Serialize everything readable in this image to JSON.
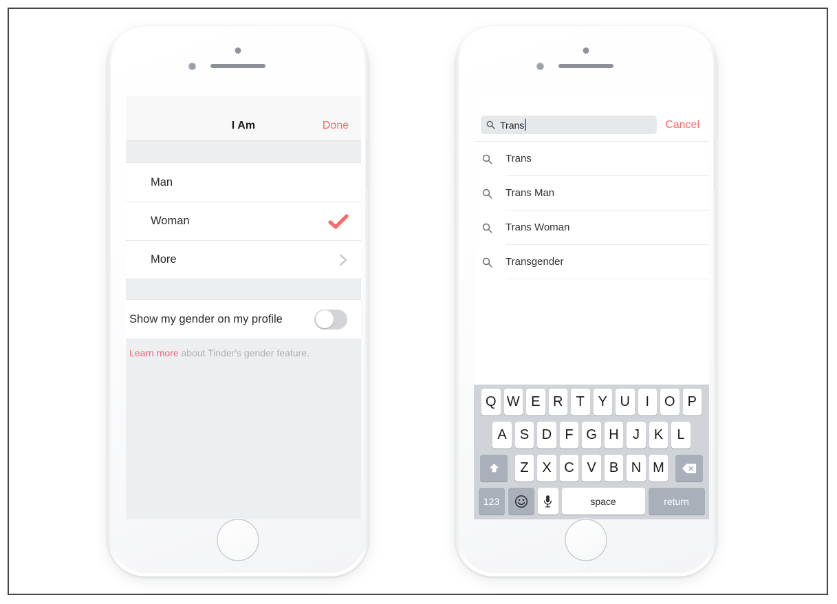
{
  "left_phone": {
    "navbar": {
      "title": "I Am",
      "done_label": "Done"
    },
    "options": [
      {
        "label": "Man",
        "accessory": "none",
        "name": "option-man"
      },
      {
        "label": "Woman",
        "accessory": "check",
        "name": "option-woman"
      },
      {
        "label": "More",
        "accessory": "chevron",
        "name": "option-more"
      }
    ],
    "toggle": {
      "label": "Show my gender on my profile",
      "state": "off"
    },
    "footnote": {
      "link_label": "Learn more",
      "rest_text": " about Tinder's gender feature."
    },
    "colors": {
      "accent_red": "#fb6a6a",
      "link_pink": "#f2647e",
      "band_grey": "#eceef0"
    }
  },
  "right_phone": {
    "search": {
      "value": "Trans",
      "placeholder": "Search",
      "icon": "search-icon",
      "cancel_label": "Cancel",
      "caret_color": "#2f7cf6"
    },
    "results": [
      {
        "label": "Trans",
        "icon": "search-icon"
      },
      {
        "label": "Trans Man",
        "icon": "search-icon"
      },
      {
        "label": "Trans Woman",
        "icon": "search-icon"
      },
      {
        "label": "Transgender",
        "icon": "search-icon"
      }
    ],
    "keyboard": {
      "row1": [
        "Q",
        "W",
        "E",
        "R",
        "T",
        "Y",
        "U",
        "I",
        "O",
        "P"
      ],
      "row2": [
        "A",
        "S",
        "D",
        "F",
        "G",
        "H",
        "J",
        "K",
        "L"
      ],
      "row3": [
        "Z",
        "X",
        "C",
        "V",
        "B",
        "N",
        "M"
      ],
      "shift_icon": "shift-arrow-icon",
      "backspace_icon": "backspace-icon",
      "numbers_label": "123",
      "emoji_icon": "emoji-smiley-icon",
      "mic_icon": "microphone-icon",
      "space_label": "space",
      "return_label": "return"
    }
  }
}
